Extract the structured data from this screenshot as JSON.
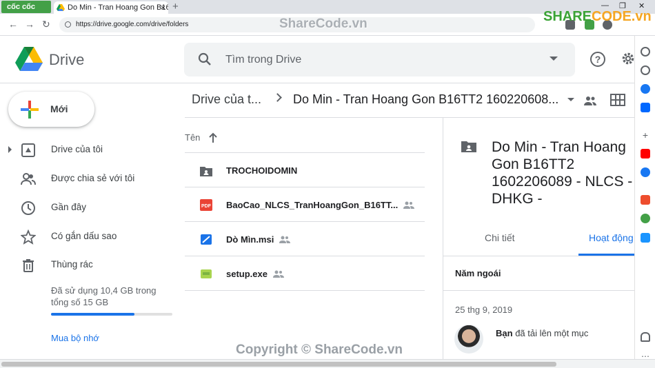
{
  "browser": {
    "brand": "cốc cốc",
    "tab_title": "Do Min - Tran Hoang Gon B16",
    "tab_close": "×",
    "new_tab": "+",
    "url": "https://drive.google.com/drive/folders",
    "minimize": "—",
    "maximize": "❐",
    "close": "✕"
  },
  "watermarks": {
    "top": "ShareCode.vn",
    "bottom": "Copyright © ShareCode.vn",
    "logo_green": "SHARE",
    "logo_orange": "CODE.vn"
  },
  "header": {
    "app_name": "Drive",
    "search_placeholder": "Tìm trong Drive",
    "help": "?"
  },
  "sidebar": {
    "new_label": "Mới",
    "items": [
      {
        "label": "Drive của tôi"
      },
      {
        "label": "Được chia sẻ với tôi"
      },
      {
        "label": "Gần đây"
      },
      {
        "label": "Có gắn dấu sao"
      },
      {
        "label": "Thùng rác"
      }
    ],
    "storage_text": "Đã sử dụng 10,4 GB trong tổng số 15 GB",
    "storage_used_fraction": 0.69,
    "buy_storage": "Mua bộ nhớ"
  },
  "breadcrumb": {
    "root": "Drive của t...",
    "current": "Do Min - Tran Hoang Gon B16TT2 160220608..."
  },
  "file_list": {
    "column_name": "Tên",
    "files": [
      {
        "name": "TROCHOIDOMIN",
        "icon": "folder-icon",
        "shared": false
      },
      {
        "name": "BaoCao_NLCS_TranHoangGon_B16TT...",
        "icon": "pdf-icon",
        "shared": true
      },
      {
        "name": "Dò Mìn.msi",
        "icon": "msi-icon",
        "shared": true
      },
      {
        "name": "setup.exe",
        "icon": "exe-icon",
        "shared": true
      }
    ]
  },
  "details": {
    "title": "Do Min - Tran Hoang Gon B16TT2 1602206089 - NLCS - DHKG -",
    "tab_details": "Chi tiết",
    "tab_activity": "Hoạt động",
    "period": "Năm ngoái",
    "date": "25 thg 9, 2019",
    "actor": "Bạn",
    "action": "đã tải lên một mục"
  },
  "colors": {
    "accent": "#1a73e8",
    "pdf": "#ea4335",
    "folder": "#5f6368"
  }
}
